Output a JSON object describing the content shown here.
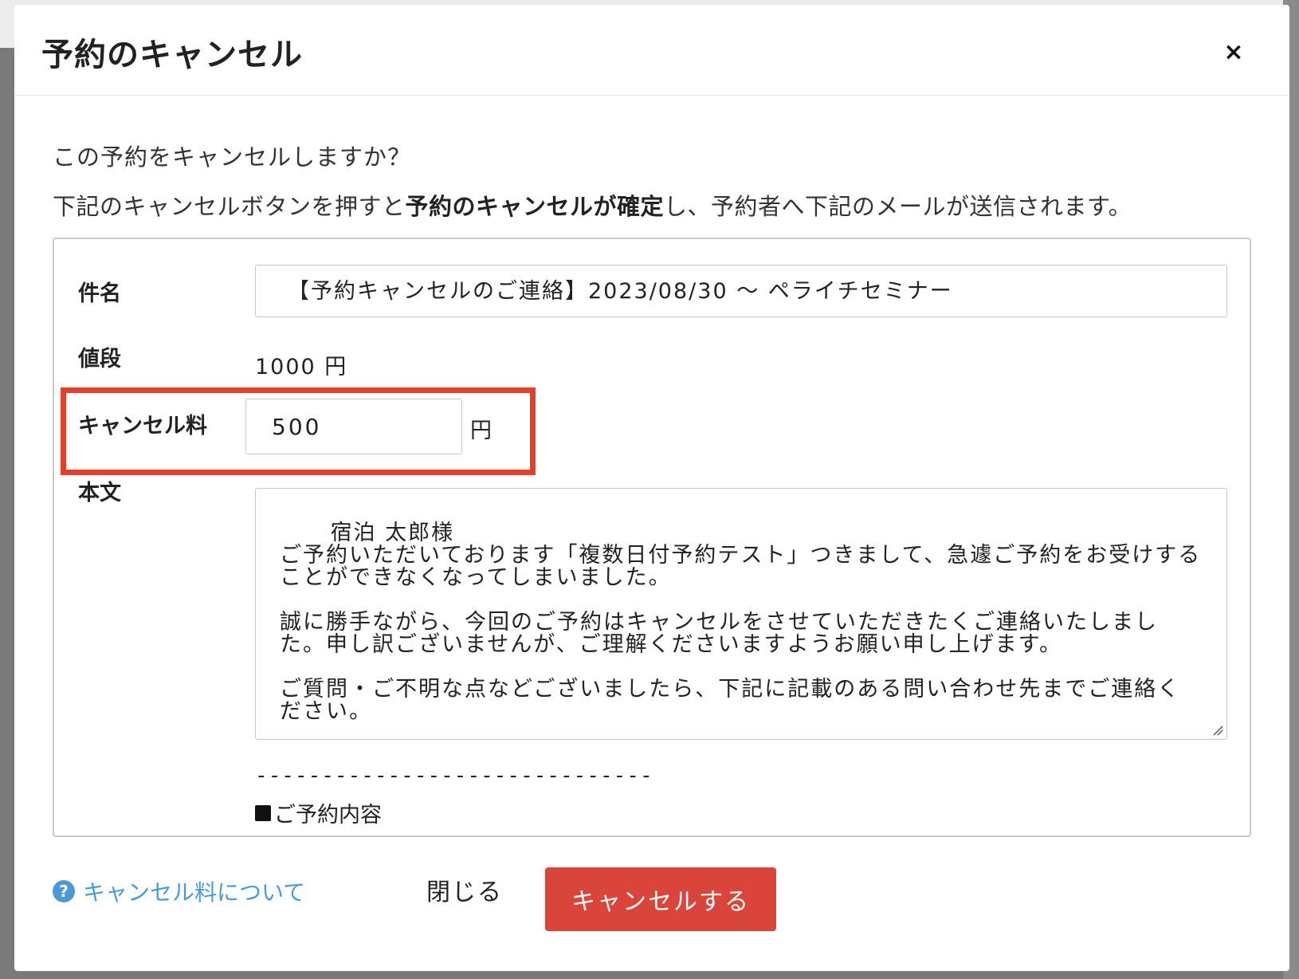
{
  "modal": {
    "title": "予約のキャンセル",
    "close_icon": "×"
  },
  "intro": {
    "question": "この予約をキャンセルしますか？",
    "notice_prefix": "下記のキャンセルボタンを押すと",
    "notice_bold": "予約のキャンセルが確定",
    "notice_suffix": "し、予約者へ下記のメールが送信されます。"
  },
  "mail": {
    "subject_label": "件名",
    "subject_value": "【予約キャンセルのご連絡】2023/08/30 〜 ペライチセミナー",
    "price_label": "値段",
    "price_value": "1000 円",
    "fee_label": "キャンセル料",
    "fee_value": "500",
    "fee_unit": "円",
    "body_label": "本文",
    "body_text": "宿泊 太郎様\nご予約いただいております「複数日付予約テスト」つきまして、急遽ご予約をお受けすることができなくなってしまいました。\n\n誠に勝手ながら、今回のご予約はキャンセルをさせていただきたくご連絡いたしました。申し訳ございませんが、ご理解くださいますようお願い申し上げます。\n\nご質問・ご不明な点などございましたら、下記に記載のある問い合わせ先までご連絡ください。",
    "separator": "------------------------------",
    "reservation_heading": "ご予約内容"
  },
  "footer": {
    "help_icon": "?",
    "help_link": "キャンセル料について",
    "close_label": "閉じる",
    "cancel_label": "キャンセルする"
  },
  "colors": {
    "highlight": "#e2402c",
    "primary_danger": "#d9453a",
    "link": "#4a9ad6"
  }
}
